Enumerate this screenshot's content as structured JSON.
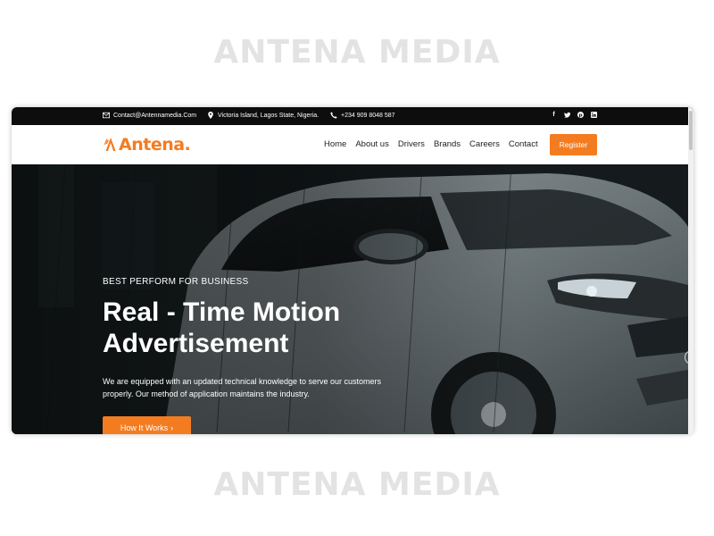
{
  "watermark": {
    "top": "ANTENA MEDIA",
    "bottom": "ANTENA MEDIA"
  },
  "topbar": {
    "email": "Contact@Antennamedia.Com",
    "location": "Victoria Island, Lagos State, Nigeria.",
    "phone": "+234 909 8048 587",
    "socials": [
      "facebook-icon",
      "twitter-icon",
      "pinterest-icon",
      "linkedin-icon"
    ]
  },
  "brand": {
    "logo_text": "Antena.",
    "accent": "#f47c20"
  },
  "nav": {
    "links": [
      "Home",
      "About us",
      "Drivers",
      "Brands",
      "Careers",
      "Contact"
    ],
    "register_label": "Register"
  },
  "hero": {
    "eyebrow": "BEST PERFORM FOR BUSINESS",
    "title": "Real - Time Motion Advertisement",
    "description": "We are equipped with an updated technical knowledge to serve our customers properly. Our method of application maintains the industry.",
    "cta_label": "How It Works",
    "cta_icon": "chevron-right-icon"
  }
}
